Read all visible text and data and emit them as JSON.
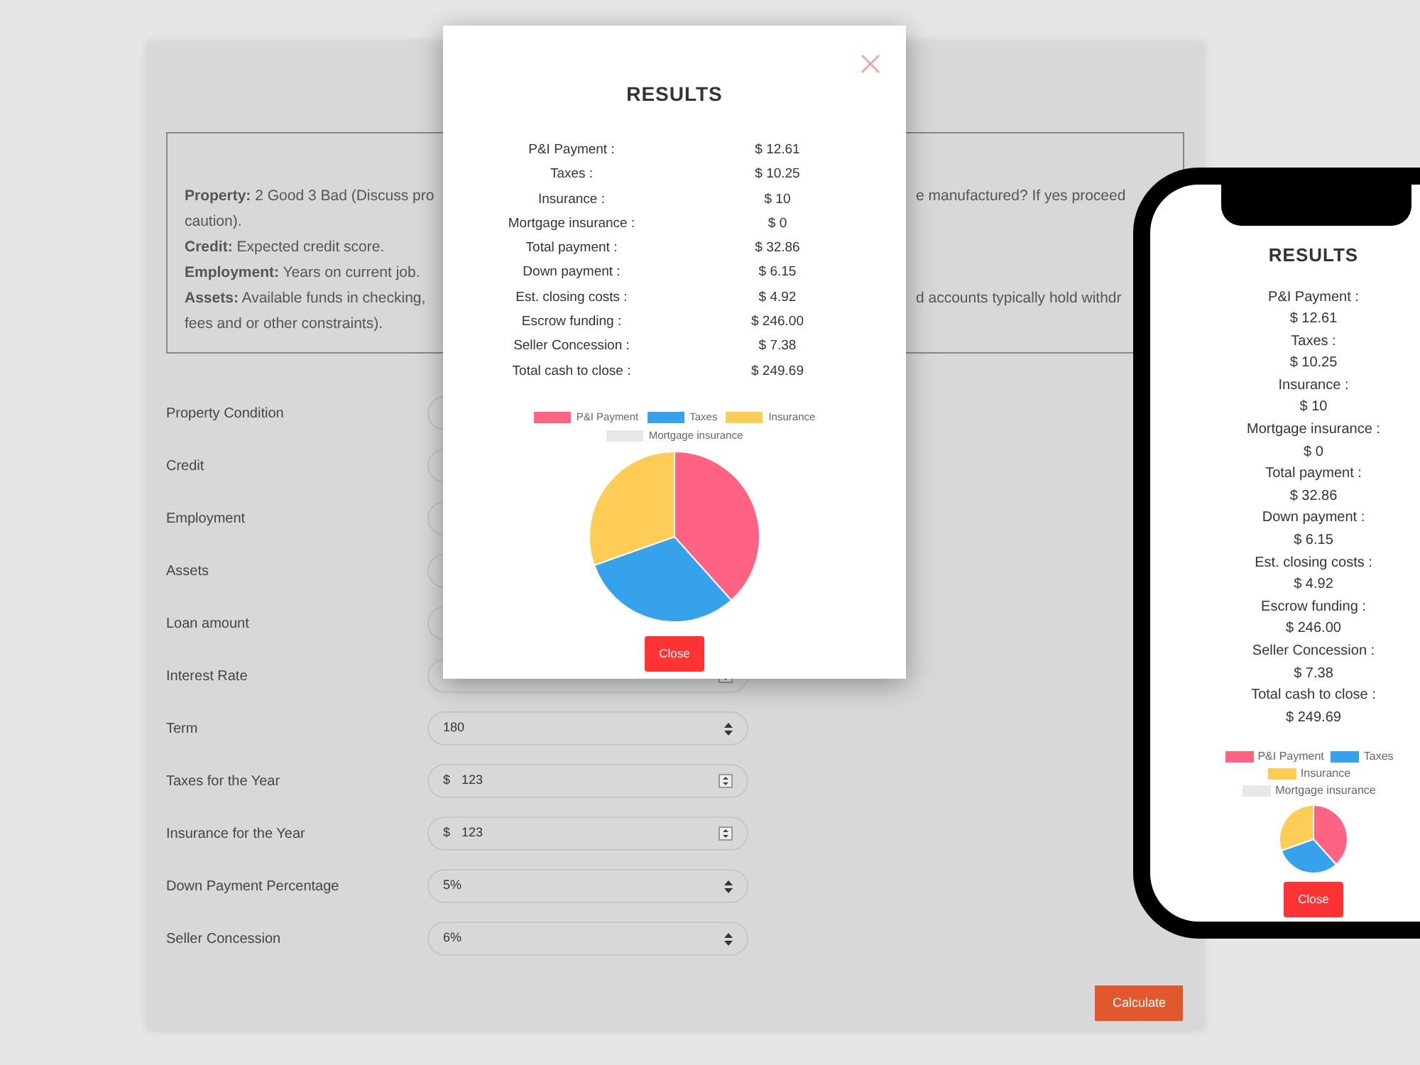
{
  "form": {
    "info": [
      {
        "left": "**Property:** 2 Good 3 Bad (Discuss pro",
        "right": "e manufactured? If yes proceed"
      },
      {
        "left": "caution)."
      },
      {
        "left": "**Credit:** Expected credit score."
      },
      {
        "left": "**Employment:** Years on current job."
      },
      {
        "left": "**Assets:** Available funds in checking,",
        "right": "d accounts typically hold withdr"
      },
      {
        "left": "fees and or other constraints)."
      }
    ],
    "fields": [
      {
        "label": "Property Condition",
        "kind": "covered"
      },
      {
        "label": "Credit",
        "kind": "covered"
      },
      {
        "label": "Employment",
        "kind": "covered"
      },
      {
        "label": "Assets",
        "kind": "covered"
      },
      {
        "label": "Loan amount",
        "kind": "covered"
      },
      {
        "label": "Interest Rate",
        "kind": "number"
      },
      {
        "label": "Term",
        "kind": "select",
        "value": "180"
      },
      {
        "label": "Taxes for the Year",
        "kind": "number",
        "prefix": "$",
        "value": "123"
      },
      {
        "label": "Insurance for the Year",
        "kind": "number",
        "prefix": "$",
        "value": "123"
      },
      {
        "label": "Down Payment Percentage",
        "kind": "select",
        "value": "5%"
      },
      {
        "label": "Seller Concession",
        "kind": "select",
        "value": "6%"
      }
    ],
    "calculate_button": "Calculate"
  },
  "modal": {
    "title": "RESULTS",
    "rows": [
      {
        "label": "P&I Payment :",
        "value": "$ 12.61"
      },
      {
        "label": "Taxes :",
        "value": "$ 10.25"
      },
      {
        "label": "Insurance :",
        "value": "$ 10"
      },
      {
        "label": "Mortgage insurance :",
        "value": "$ 0"
      },
      {
        "label": "Total payment :",
        "value": "$ 32.86"
      },
      {
        "label": "Down payment :",
        "value": "$ 6.15"
      },
      {
        "label": "Est. closing costs :",
        "value": "$ 4.92"
      },
      {
        "label": "Escrow funding :",
        "value": "$ 246.00"
      },
      {
        "label": "Seller Concession :",
        "value": "$ 7.38"
      },
      {
        "label": "Total cash to close :",
        "value": "$ 249.69"
      }
    ],
    "chart_data": {
      "type": "pie",
      "legend": "top",
      "categories": [
        "P&I Payment",
        "Taxes",
        "Insurance",
        "Mortgage insurance"
      ],
      "colors": [
        "#ff6384",
        "#36a2eb",
        "#ffcd56",
        "#e7e7e7"
      ],
      "series": [
        {
          "values": [
            38.38,
            31.19,
            30.43,
            0
          ]
        }
      ]
    },
    "close_button": "Close"
  },
  "phone": {
    "title": "RESULTS",
    "rows": [
      {
        "label": "P&I Payment :",
        "value": "$ 12.61"
      },
      {
        "label": "Taxes :",
        "value": "$ 10.25"
      },
      {
        "label": "Insurance :",
        "value": "$ 10"
      },
      {
        "label": "Mortgage insurance :",
        "value": "$ 0"
      },
      {
        "label": "Total payment :",
        "value": "$ 32.86"
      },
      {
        "label": "Down payment :",
        "value": "$ 6.15"
      },
      {
        "label": "Est. closing costs :",
        "value": "$ 4.92"
      },
      {
        "label": "Escrow funding :",
        "value": "$ 246.00"
      },
      {
        "label": "Seller Concession :",
        "value": "$ 7.38"
      },
      {
        "label": "Total cash to close :",
        "value": "$ 249.69"
      }
    ],
    "chart_data": {
      "type": "pie",
      "legend": "top",
      "categories": [
        "P&I Payment",
        "Taxes",
        "Insurance",
        "Mortgage insurance"
      ],
      "colors": [
        "#ff6384",
        "#36a2eb",
        "#ffcd56",
        "#e7e7e7"
      ],
      "series": [
        {
          "values": [
            38.38,
            31.19,
            30.43,
            0
          ]
        }
      ]
    },
    "close_button": "Close"
  }
}
